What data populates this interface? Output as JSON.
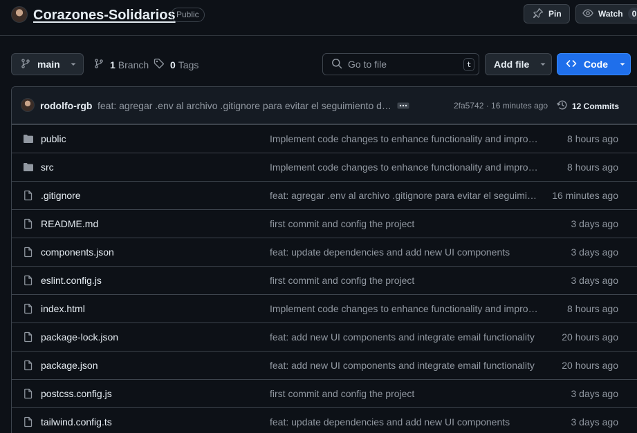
{
  "repo": {
    "name": "Corazones-Solidarios",
    "visibility": "Public",
    "pin_label": "Pin",
    "watch_label": "Watch",
    "watch_count": "0"
  },
  "toolbar": {
    "branch": "main",
    "branch_count": "1",
    "branch_label": "Branch",
    "tag_count": "0",
    "tag_label": "Tags",
    "search_placeholder": "Go to file",
    "search_shortcut": "t",
    "add_file_label": "Add file",
    "code_label": "Code"
  },
  "last_commit": {
    "author": "rodolfo-rgb",
    "message": "feat: agregar .env al archivo .gitignore para evitar el seguimiento de archivos de entorno",
    "sha_time": "2fa5742 · 16 minutes ago",
    "commits_label": "12 Commits"
  },
  "files": [
    {
      "type": "folder",
      "name": "public",
      "message": "Implement code changes to enhance functionality and improve performance",
      "time": "8 hours ago"
    },
    {
      "type": "folder",
      "name": "src",
      "message": "Implement code changes to enhance functionality and improve performance",
      "time": "8 hours ago"
    },
    {
      "type": "file",
      "name": ".gitignore",
      "message": "feat: agregar .env al archivo .gitignore para evitar el seguimiento de archivos",
      "time": "16 minutes ago"
    },
    {
      "type": "file",
      "name": "README.md",
      "message": "first commit and config the project",
      "time": "3 days ago"
    },
    {
      "type": "file",
      "name": "components.json",
      "message": "feat: update dependencies and add new UI components",
      "time": "3 days ago"
    },
    {
      "type": "file",
      "name": "eslint.config.js",
      "message": "first commit and config the project",
      "time": "3 days ago"
    },
    {
      "type": "file",
      "name": "index.html",
      "message": "Implement code changes to enhance functionality and improve performance",
      "time": "8 hours ago"
    },
    {
      "type": "file",
      "name": "package-lock.json",
      "message": "feat: add new UI components and integrate email functionality",
      "time": "20 hours ago"
    },
    {
      "type": "file",
      "name": "package.json",
      "message": "feat: add new UI components and integrate email functionality",
      "time": "20 hours ago"
    },
    {
      "type": "file",
      "name": "postcss.config.js",
      "message": "first commit and config the project",
      "time": "3 days ago"
    },
    {
      "type": "file",
      "name": "tailwind.config.ts",
      "message": "feat: update dependencies and add new UI components",
      "time": "3 days ago"
    }
  ],
  "colors": {
    "background": "#0d1117",
    "border": "#3d444d",
    "accent_blue": "#1f6feb",
    "muted_text": "#9198a1",
    "icon_gray": "#9198a1"
  },
  "icons": {
    "folder": "folder-icon",
    "file": "file-icon",
    "branch": "git-branch-icon",
    "tag": "tag-icon",
    "search": "search-icon",
    "pin": "pin-icon",
    "watch": "eye-icon",
    "code": "code-icon",
    "history": "history-icon",
    "ellipsis": "ellipsis-icon"
  }
}
